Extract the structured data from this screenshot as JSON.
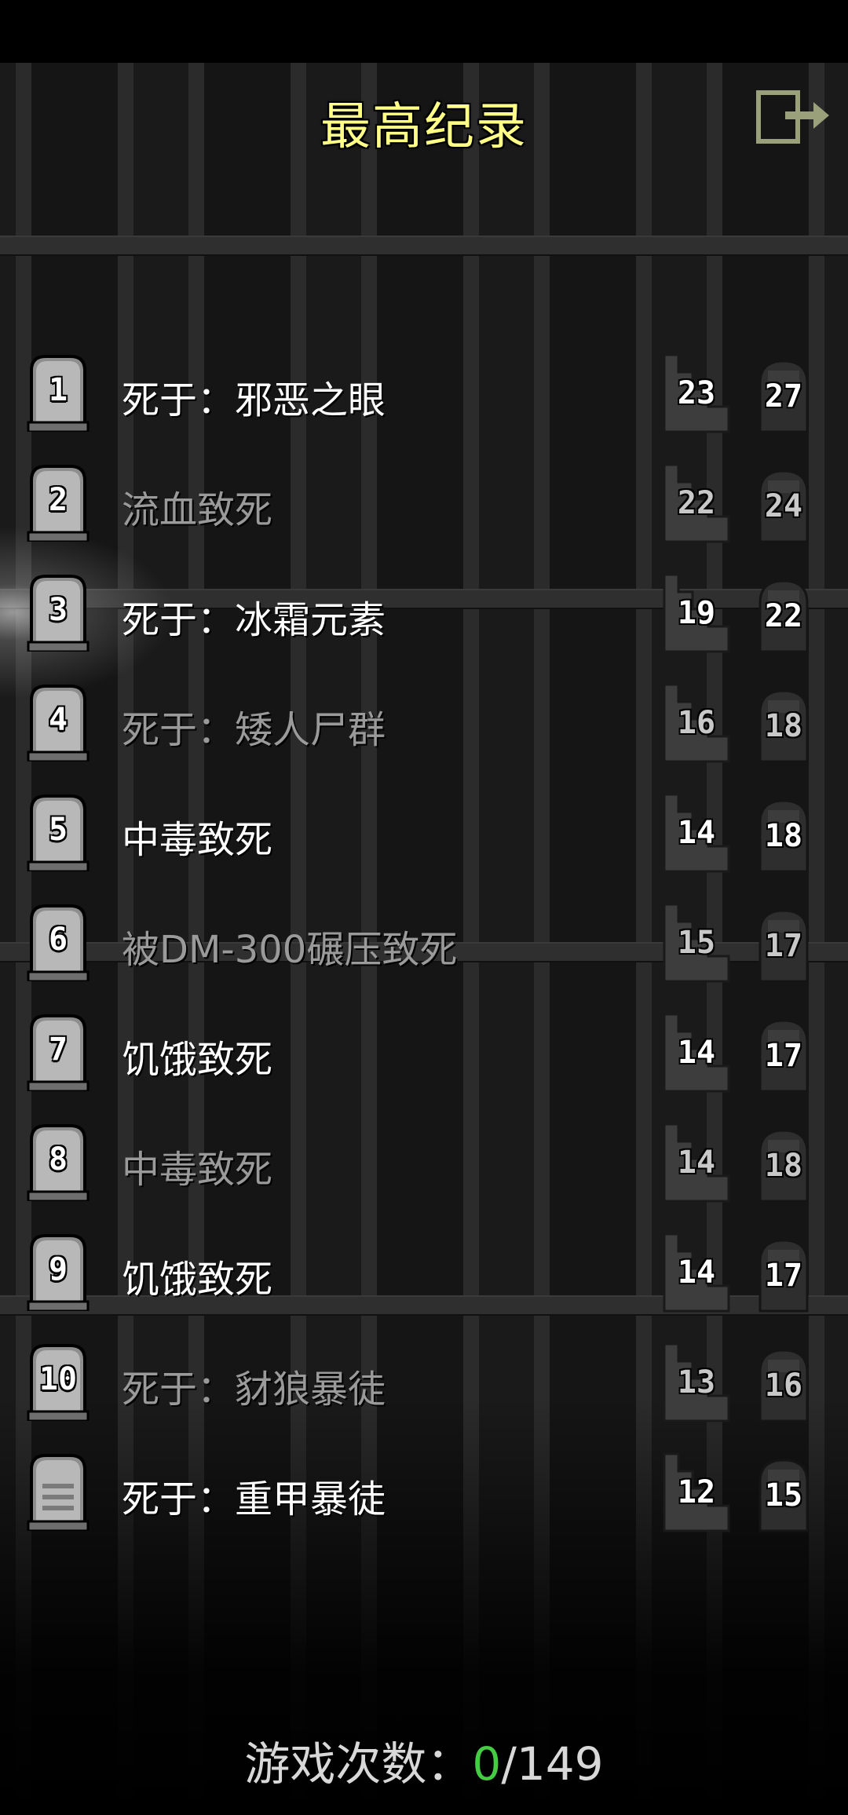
{
  "header": {
    "title": "最高纪录"
  },
  "records": [
    {
      "rank": "1",
      "cause": "死于：邪恶之眼",
      "depth": "23",
      "level": "27",
      "dim": false
    },
    {
      "rank": "2",
      "cause": "流血致死",
      "depth": "22",
      "level": "24",
      "dim": true
    },
    {
      "rank": "3",
      "cause": "死于：冰霜元素",
      "depth": "19",
      "level": "22",
      "dim": false
    },
    {
      "rank": "4",
      "cause": "死于：矮人尸群",
      "depth": "16",
      "level": "18",
      "dim": true
    },
    {
      "rank": "5",
      "cause": "中毒致死",
      "depth": "14",
      "level": "18",
      "dim": false
    },
    {
      "rank": "6",
      "cause": "被DM-300碾压致死",
      "depth": "15",
      "level": "17",
      "dim": true
    },
    {
      "rank": "7",
      "cause": "饥饿致死",
      "depth": "14",
      "level": "17",
      "dim": false
    },
    {
      "rank": "8",
      "cause": "中毒致死",
      "depth": "14",
      "level": "18",
      "dim": true
    },
    {
      "rank": "9",
      "cause": "饥饿致死",
      "depth": "14",
      "level": "17",
      "dim": false
    },
    {
      "rank": "10",
      "cause": "死于：豺狼暴徒",
      "depth": "13",
      "level": "16",
      "dim": true
    },
    {
      "rank": "",
      "cause": "死于：重甲暴徒",
      "depth": "12",
      "level": "15",
      "dim": false
    }
  ],
  "footer": {
    "label": "游戏次数：",
    "current": "0",
    "total": "/149"
  },
  "colors": {
    "title": "#ffff88",
    "counter_current": "#44cc44"
  },
  "icons": {
    "exit": "exit-icon",
    "tombstone": "tombstone-icon",
    "depth": "stairs-icon",
    "level": "hero-level-icon"
  }
}
